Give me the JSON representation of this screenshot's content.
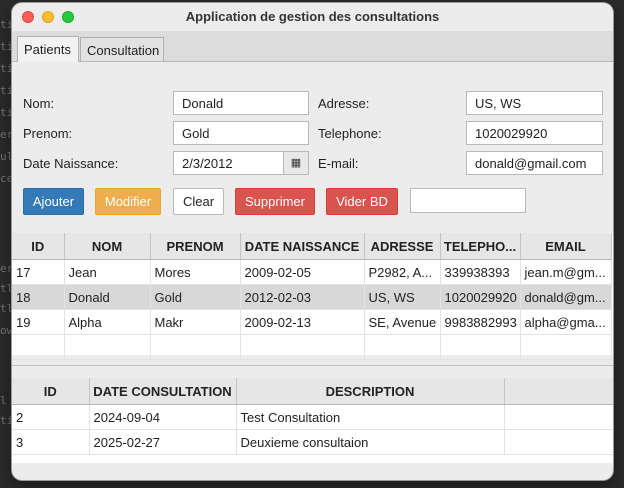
{
  "window": {
    "title": "Application de gestion des consultations"
  },
  "tabs": [
    "Patients",
    "Consultation"
  ],
  "form": {
    "nom": {
      "label": "Nom:",
      "value": "Donald"
    },
    "prenom": {
      "label": "Prenom:",
      "value": "Gold"
    },
    "date_naissance": {
      "label": "Date Naissance:",
      "value": "2/3/2012"
    },
    "adresse": {
      "label": "Adresse:",
      "value": "US, WS"
    },
    "telephone": {
      "label": "Telephone:",
      "value": "1020029920"
    },
    "email": {
      "label": "E-mail:",
      "value": "donald@gmail.com"
    }
  },
  "buttons": {
    "ajouter": "Ajouter",
    "modifier": "Modifier",
    "clear": "Clear",
    "supprimer": "Supprimer",
    "vider": "Vider BD",
    "search_value": ""
  },
  "patients_table": {
    "columns": [
      "ID",
      "NOM",
      "PRENOM",
      "DATE NAISSANCE",
      "ADRESSE",
      "TELEPHO...",
      "EMAIL"
    ],
    "rows": [
      [
        "17",
        "Jean",
        "Mores",
        "2009-02-05",
        "P2982, A...",
        "339938393",
        "jean.m@gm..."
      ],
      [
        "18",
        "Donald",
        "Gold",
        "2012-02-03",
        "US, WS",
        "1020029920",
        "donald@gm..."
      ],
      [
        "19",
        "Alpha",
        "Makr",
        "2009-02-13",
        "SE, Avenue",
        "9983882993",
        "alpha@gma..."
      ]
    ],
    "selected_row": 1
  },
  "consultations_table": {
    "columns": [
      "ID",
      "DATE CONSULTATION",
      "DESCRIPTION"
    ],
    "rows": [
      [
        "2",
        "2024-09-04",
        "Test Consultation"
      ],
      [
        "3",
        "2025-02-27",
        "Deuxieme consultaion"
      ]
    ]
  },
  "colors": {
    "primary": "#337ab7",
    "warning": "#f0ad4e",
    "danger": "#d9534f"
  }
}
